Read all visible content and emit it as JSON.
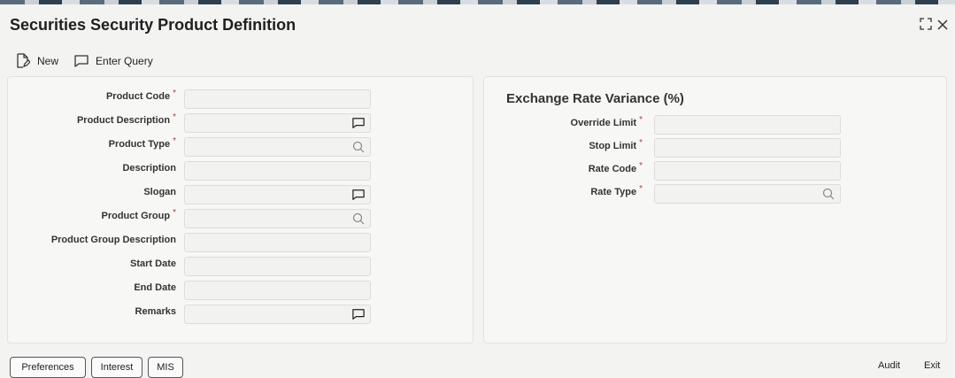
{
  "window": {
    "title": "Securities Security Product Definition"
  },
  "toolbar": {
    "new_label": "New",
    "enter_query_label": "Enter Query"
  },
  "left_form": {
    "product_code": {
      "label": "Product Code",
      "value": ""
    },
    "product_description": {
      "label": "Product Description",
      "value": ""
    },
    "product_type": {
      "label": "Product Type",
      "value": ""
    },
    "description": {
      "label": "Description",
      "value": ""
    },
    "slogan": {
      "label": "Slogan",
      "value": ""
    },
    "product_group": {
      "label": "Product Group",
      "value": ""
    },
    "product_group_description": {
      "label": "Product Group Description",
      "value": ""
    },
    "start_date": {
      "label": "Start Date",
      "value": ""
    },
    "end_date": {
      "label": "End Date",
      "value": ""
    },
    "remarks": {
      "label": "Remarks",
      "value": ""
    }
  },
  "right_form": {
    "section_title": "Exchange Rate Variance (%)",
    "override_limit": {
      "label": "Override Limit",
      "value": ""
    },
    "stop_limit": {
      "label": "Stop Limit",
      "value": ""
    },
    "rate_code": {
      "label": "Rate Code",
      "value": ""
    },
    "rate_type": {
      "label": "Rate Type",
      "value": ""
    }
  },
  "required_marker": "*",
  "footer": {
    "preferences_label": "Preferences",
    "interest_label": "Interest",
    "mis_label": "MIS",
    "audit_label": "Audit",
    "exit_label": "Exit"
  },
  "colors": {
    "required": "#c0392b",
    "background": "#f3f3f2"
  }
}
